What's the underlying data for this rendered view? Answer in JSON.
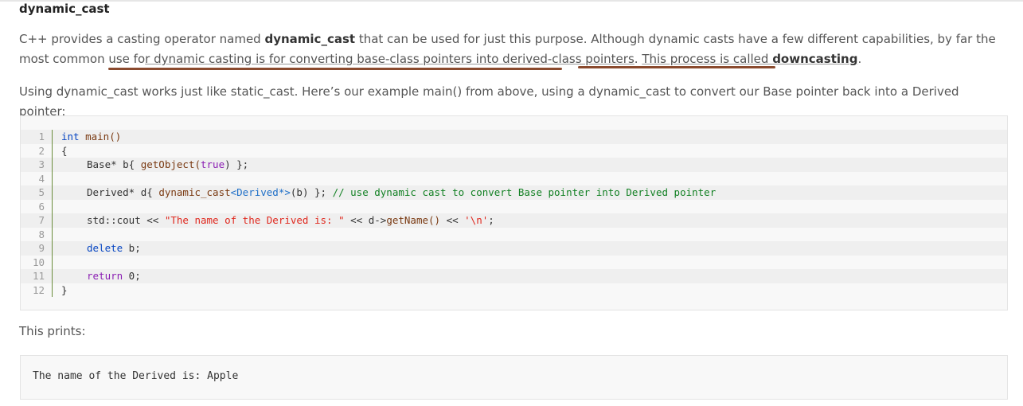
{
  "heading": "dynamic_cast",
  "para1": {
    "t1": "C++ provides a casting operator named ",
    "b1": "dynamic_cast",
    "t2": " that can be used for just this purpose. Although dynamic casts have a few different capabilities, by far the most common use fo",
    "l1": "r dynamic casting is for converting base-class pointers into derived-class pointers",
    "t3": ". ",
    "l2a": "This process is called ",
    "l2b": "downcasting",
    "t4": "."
  },
  "para2": "Using dynamic_cast works just like static_cast. Here’s our example main() from above, using a dynamic_cast to convert our Base pointer back into a Derived pointer:",
  "code": {
    "line_numbers": [
      "1",
      "2",
      "3",
      "4",
      "5",
      "6",
      "7",
      "8",
      "9",
      "10",
      "11",
      "12"
    ],
    "l1_kw": "int",
    "l1_fn": " main()",
    "l2": "{",
    "l3_a": "Base* b{ ",
    "l3_fn": "getObject(",
    "l3_kw": "true",
    "l3_b": ") };",
    "l5_a": "Derived* d{ ",
    "l5_fn": "dynamic_cast",
    "l5_tp": "<Derived*>",
    "l5_b": "(b) }; ",
    "l5_cmt": "// use dynamic cast to convert Base pointer into Derived pointer",
    "l7_a": "std::cout << ",
    "l7_str": "\"The name of the Derived is: \"",
    "l7_b": " << d->",
    "l7_fn": "getName()",
    "l7_c": " << ",
    "l7_str2": "'\\n'",
    "l7_d": ";",
    "l9_kw": "delete",
    "l9_a": " b;",
    "l11_kw": "return",
    "l11_a": " 0;",
    "l12": "}"
  },
  "prints_label": "This prints:",
  "output": "The name of the Derived is: Apple",
  "colors": {
    "highlight_underline": "#8a4a2e",
    "keyword": "#0645c2",
    "string": "#e0281e",
    "comment": "#128023"
  }
}
